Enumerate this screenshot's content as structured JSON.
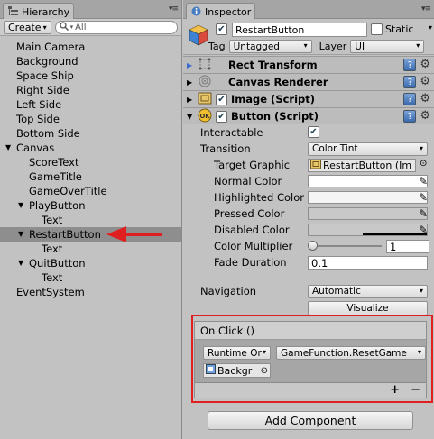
{
  "hierarchy": {
    "tab_title": "Hierarchy",
    "create_label": "Create",
    "search_placeholder": "All",
    "items": [
      {
        "label": "Main Camera",
        "indent": 0
      },
      {
        "label": "Background",
        "indent": 0
      },
      {
        "label": "Space Ship",
        "indent": 0
      },
      {
        "label": "Right Side",
        "indent": 0
      },
      {
        "label": "Left Side",
        "indent": 0
      },
      {
        "label": "Top Side",
        "indent": 0
      },
      {
        "label": "Bottom Side",
        "indent": 0
      },
      {
        "label": "Canvas",
        "indent": 0,
        "expanded": true
      },
      {
        "label": "ScoreText",
        "indent": 1
      },
      {
        "label": "GameTitle",
        "indent": 1
      },
      {
        "label": "GameOverTitle",
        "indent": 1
      },
      {
        "label": "PlayButton",
        "indent": 1,
        "expanded": true
      },
      {
        "label": "Text",
        "indent": 2
      },
      {
        "label": "RestartButton",
        "indent": 1,
        "expanded": true,
        "selected": true
      },
      {
        "label": "Text",
        "indent": 2
      },
      {
        "label": "QuitButton",
        "indent": 1,
        "expanded": true
      },
      {
        "label": "Text",
        "indent": 2
      },
      {
        "label": "EventSystem",
        "indent": 0
      }
    ]
  },
  "inspector": {
    "tab_title": "Inspector",
    "object_name": "RestartButton",
    "static_label": "Static",
    "tag_label": "Tag",
    "tag_value": "Untagged",
    "layer_label": "Layer",
    "layer_value": "UI",
    "components": {
      "rect_transform": "Rect Transform",
      "canvas_renderer": "Canvas Renderer",
      "image": "Image (Script)",
      "button": "Button (Script)"
    },
    "button_props": {
      "interactable": "Interactable",
      "transition": "Transition",
      "transition_value": "Color Tint",
      "target_graphic": "Target Graphic",
      "target_graphic_value": "RestartButton (Im",
      "normal_color": "Normal Color",
      "highlighted_color": "Highlighted Color",
      "pressed_color": "Pressed Color",
      "disabled_color": "Disabled Color",
      "color_multiplier": "Color Multiplier",
      "color_multiplier_value": "1",
      "color_multiplier_slider": 0.0,
      "fade_duration": "Fade Duration",
      "fade_duration_value": "0.1",
      "navigation": "Navigation",
      "navigation_value": "Automatic",
      "visualize": "Visualize"
    },
    "onclick": {
      "title": "On Click ()",
      "runtime": "Runtime Or",
      "function": "GameFunction.ResetGame",
      "object": "Backgr",
      "plus": "+",
      "minus": "−"
    },
    "add_component": "Add Component"
  },
  "colors": {
    "normal": "#ffffff",
    "highlighted": "#f5f5f5",
    "pressed": "#c8c8c8",
    "disabled": "#c8c8c8",
    "annotation_red": "#e02020",
    "selection": "#8e8e8e"
  }
}
